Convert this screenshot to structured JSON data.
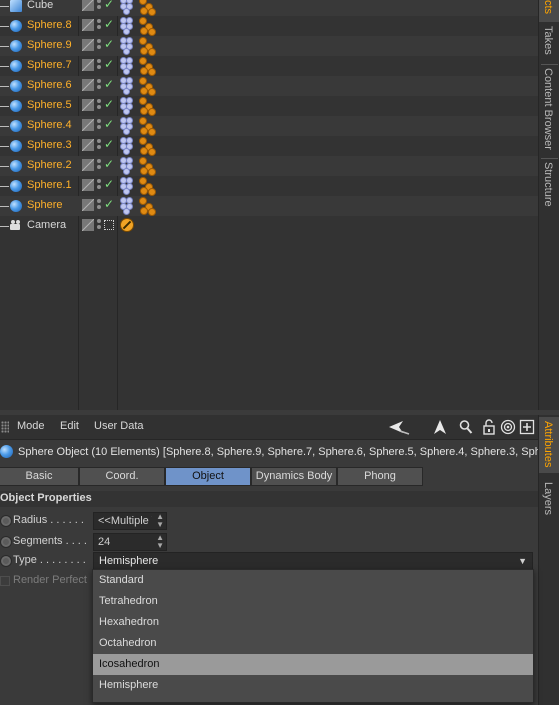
{
  "object_manager": {
    "objects": [
      {
        "name": "Cube",
        "icon": "cube-icon",
        "selected": false
      },
      {
        "name": "Sphere.8",
        "icon": "sphere-icon",
        "selected": true
      },
      {
        "name": "Sphere.9",
        "icon": "sphere-icon",
        "selected": true
      },
      {
        "name": "Sphere.7",
        "icon": "sphere-icon",
        "selected": true
      },
      {
        "name": "Sphere.6",
        "icon": "sphere-icon",
        "selected": true
      },
      {
        "name": "Sphere.5",
        "icon": "sphere-icon",
        "selected": true
      },
      {
        "name": "Sphere.4",
        "icon": "sphere-icon",
        "selected": true
      },
      {
        "name": "Sphere.3",
        "icon": "sphere-icon",
        "selected": true
      },
      {
        "name": "Sphere.2",
        "icon": "sphere-icon",
        "selected": true
      },
      {
        "name": "Sphere.1",
        "icon": "sphere-icon",
        "selected": true
      },
      {
        "name": "Sphere",
        "icon": "sphere-icon",
        "selected": true
      },
      {
        "name": "Camera",
        "icon": "camera-icon",
        "selected": false
      }
    ]
  },
  "side_tabs_top": [
    "cts",
    "Takes",
    "Content Browser",
    "Structure"
  ],
  "side_tabs_bottom": [
    "Attributes",
    "Layers"
  ],
  "attributes": {
    "menu": [
      "Mode",
      "Edit",
      "User Data"
    ],
    "object_info": "Sphere Object (10 Elements) [Sphere.8, Sphere.9, Sphere.7, Sphere.6, Sphere.5, Sphere.4, Sphere.3, Sph",
    "tabs": [
      "Basic",
      "Coord.",
      "Object",
      "Dynamics Body",
      "Phong"
    ],
    "active_tab": "Object",
    "section_title": "Object Properties",
    "radius": {
      "label": "Radius . . . . . .",
      "value": "<<Multiple V"
    },
    "segments": {
      "label": "Segments . . . .",
      "value": "24"
    },
    "type": {
      "label": "Type . . . . . . . .",
      "value": "Hemisphere"
    },
    "render_perfect": {
      "label": "Render Perfect"
    },
    "type_options": [
      "Standard",
      "Tetrahedron",
      "Hexahedron",
      "Octahedron",
      "Icosahedron",
      "Hemisphere"
    ],
    "highlighted_option": "Icosahedron"
  },
  "colors": {
    "selected_text": "#ffb12a",
    "active_tab": "#6f93c9",
    "accent_tab": "#ffa500"
  }
}
